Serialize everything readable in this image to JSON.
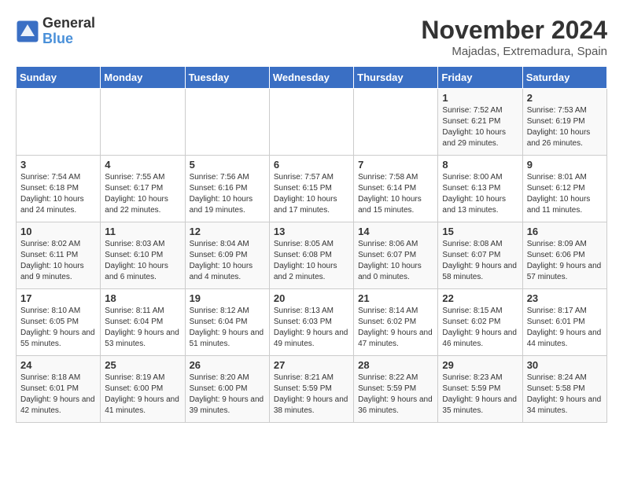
{
  "logo": {
    "line1": "General",
    "line2": "Blue"
  },
  "title": "November 2024",
  "subtitle": "Majadas, Extremadura, Spain",
  "days_of_week": [
    "Sunday",
    "Monday",
    "Tuesday",
    "Wednesday",
    "Thursday",
    "Friday",
    "Saturday"
  ],
  "weeks": [
    [
      {
        "day": "",
        "info": ""
      },
      {
        "day": "",
        "info": ""
      },
      {
        "day": "",
        "info": ""
      },
      {
        "day": "",
        "info": ""
      },
      {
        "day": "",
        "info": ""
      },
      {
        "day": "1",
        "info": "Sunrise: 7:52 AM\nSunset: 6:21 PM\nDaylight: 10 hours and 29 minutes."
      },
      {
        "day": "2",
        "info": "Sunrise: 7:53 AM\nSunset: 6:19 PM\nDaylight: 10 hours and 26 minutes."
      }
    ],
    [
      {
        "day": "3",
        "info": "Sunrise: 7:54 AM\nSunset: 6:18 PM\nDaylight: 10 hours and 24 minutes."
      },
      {
        "day": "4",
        "info": "Sunrise: 7:55 AM\nSunset: 6:17 PM\nDaylight: 10 hours and 22 minutes."
      },
      {
        "day": "5",
        "info": "Sunrise: 7:56 AM\nSunset: 6:16 PM\nDaylight: 10 hours and 19 minutes."
      },
      {
        "day": "6",
        "info": "Sunrise: 7:57 AM\nSunset: 6:15 PM\nDaylight: 10 hours and 17 minutes."
      },
      {
        "day": "7",
        "info": "Sunrise: 7:58 AM\nSunset: 6:14 PM\nDaylight: 10 hours and 15 minutes."
      },
      {
        "day": "8",
        "info": "Sunrise: 8:00 AM\nSunset: 6:13 PM\nDaylight: 10 hours and 13 minutes."
      },
      {
        "day": "9",
        "info": "Sunrise: 8:01 AM\nSunset: 6:12 PM\nDaylight: 10 hours and 11 minutes."
      }
    ],
    [
      {
        "day": "10",
        "info": "Sunrise: 8:02 AM\nSunset: 6:11 PM\nDaylight: 10 hours and 9 minutes."
      },
      {
        "day": "11",
        "info": "Sunrise: 8:03 AM\nSunset: 6:10 PM\nDaylight: 10 hours and 6 minutes."
      },
      {
        "day": "12",
        "info": "Sunrise: 8:04 AM\nSunset: 6:09 PM\nDaylight: 10 hours and 4 minutes."
      },
      {
        "day": "13",
        "info": "Sunrise: 8:05 AM\nSunset: 6:08 PM\nDaylight: 10 hours and 2 minutes."
      },
      {
        "day": "14",
        "info": "Sunrise: 8:06 AM\nSunset: 6:07 PM\nDaylight: 10 hours and 0 minutes."
      },
      {
        "day": "15",
        "info": "Sunrise: 8:08 AM\nSunset: 6:07 PM\nDaylight: 9 hours and 58 minutes."
      },
      {
        "day": "16",
        "info": "Sunrise: 8:09 AM\nSunset: 6:06 PM\nDaylight: 9 hours and 57 minutes."
      }
    ],
    [
      {
        "day": "17",
        "info": "Sunrise: 8:10 AM\nSunset: 6:05 PM\nDaylight: 9 hours and 55 minutes."
      },
      {
        "day": "18",
        "info": "Sunrise: 8:11 AM\nSunset: 6:04 PM\nDaylight: 9 hours and 53 minutes."
      },
      {
        "day": "19",
        "info": "Sunrise: 8:12 AM\nSunset: 6:04 PM\nDaylight: 9 hours and 51 minutes."
      },
      {
        "day": "20",
        "info": "Sunrise: 8:13 AM\nSunset: 6:03 PM\nDaylight: 9 hours and 49 minutes."
      },
      {
        "day": "21",
        "info": "Sunrise: 8:14 AM\nSunset: 6:02 PM\nDaylight: 9 hours and 47 minutes."
      },
      {
        "day": "22",
        "info": "Sunrise: 8:15 AM\nSunset: 6:02 PM\nDaylight: 9 hours and 46 minutes."
      },
      {
        "day": "23",
        "info": "Sunrise: 8:17 AM\nSunset: 6:01 PM\nDaylight: 9 hours and 44 minutes."
      }
    ],
    [
      {
        "day": "24",
        "info": "Sunrise: 8:18 AM\nSunset: 6:01 PM\nDaylight: 9 hours and 42 minutes."
      },
      {
        "day": "25",
        "info": "Sunrise: 8:19 AM\nSunset: 6:00 PM\nDaylight: 9 hours and 41 minutes."
      },
      {
        "day": "26",
        "info": "Sunrise: 8:20 AM\nSunset: 6:00 PM\nDaylight: 9 hours and 39 minutes."
      },
      {
        "day": "27",
        "info": "Sunrise: 8:21 AM\nSunset: 5:59 PM\nDaylight: 9 hours and 38 minutes."
      },
      {
        "day": "28",
        "info": "Sunrise: 8:22 AM\nSunset: 5:59 PM\nDaylight: 9 hours and 36 minutes."
      },
      {
        "day": "29",
        "info": "Sunrise: 8:23 AM\nSunset: 5:59 PM\nDaylight: 9 hours and 35 minutes."
      },
      {
        "day": "30",
        "info": "Sunrise: 8:24 AM\nSunset: 5:58 PM\nDaylight: 9 hours and 34 minutes."
      }
    ]
  ]
}
